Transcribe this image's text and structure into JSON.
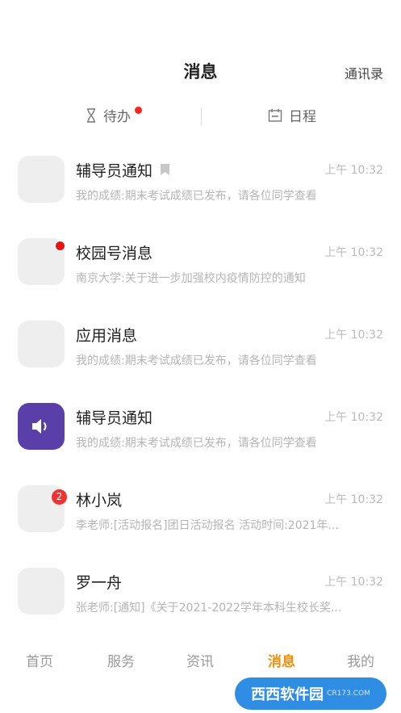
{
  "header": {
    "title": "消息",
    "contacts_label": "通讯录"
  },
  "segments": {
    "todo_label": "待办",
    "schedule_label": "日程"
  },
  "messages": [
    {
      "title": "辅导员通知",
      "time": "上午 10:32",
      "preview": "我的成绩:期末考试成绩已发布，请各位同学查看",
      "bookmark": true
    },
    {
      "title": "校园号消息",
      "time": "上午 10:32",
      "preview": "南京大学:关于进一步加强校内疫情防控的通知",
      "dot": true
    },
    {
      "title": "应用消息",
      "time": "上午 10:32",
      "preview": "我的成绩:期末考试成绩已发布，请各位同学查看"
    },
    {
      "title": "辅导员通知",
      "time": "上午 10:32",
      "preview": "我的成绩:期末考试成绩已发布，请各位同学查看",
      "icon": "speaker-icon"
    },
    {
      "title": "林小岚",
      "time": "上午 10:32",
      "preview": "李老师:[活动报名]团日活动报名 活动时间:2021年...",
      "badge": "2"
    },
    {
      "title": "罗一舟",
      "time": "上午 10:32",
      "preview": "张老师:[通知]《关于2021-2022学年本科生校长奖..."
    }
  ],
  "tabs": [
    {
      "label": "首页"
    },
    {
      "label": "服务"
    },
    {
      "label": "资讯"
    },
    {
      "label": "消息",
      "active": true
    },
    {
      "label": "我的"
    }
  ],
  "watermark": {
    "text": "西西软件园",
    "sub": "CR173.COM"
  },
  "colors": {
    "accent": "#f0900a",
    "purple": "#5a3fa8",
    "red": "#ee1111"
  }
}
